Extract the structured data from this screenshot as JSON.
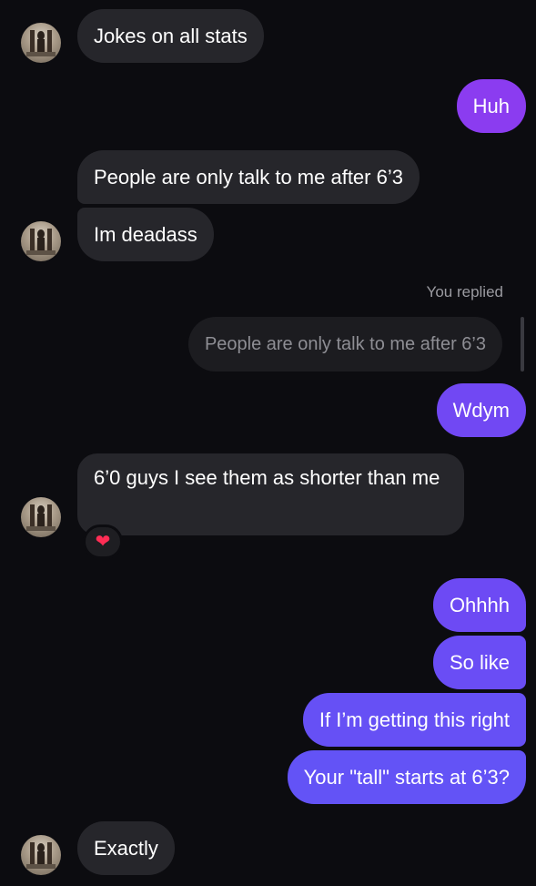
{
  "thread": {
    "messages": [
      {
        "sender": "them",
        "text": "Jokes on all stats"
      },
      {
        "sender": "me",
        "text": "Huh"
      },
      {
        "sender": "them",
        "text": "People are only talk to me after 6’3"
      },
      {
        "sender": "them",
        "text": "Im deadass"
      },
      {
        "sender": "me",
        "reply_label": "You replied",
        "quoted_text": "People are only talk to me after 6’3",
        "text": "Wdym"
      },
      {
        "sender": "them",
        "text": "6’0 guys I see them as shorter than me",
        "reaction": "❤"
      },
      {
        "sender": "me",
        "text": "Ohhhh"
      },
      {
        "sender": "me",
        "text": "So like"
      },
      {
        "sender": "me",
        "text": "If I’m getting this right"
      },
      {
        "sender": "me",
        "text": "Your \"tall\" starts at 6’3?"
      },
      {
        "sender": "them",
        "text": "Exactly"
      }
    ]
  },
  "colors": {
    "background": "#0c0c10",
    "incoming_bubble": "#26262b",
    "outgoing_purple": "#8b3cf0",
    "outgoing_blue_violet": "#6a4df5"
  },
  "icons": {
    "avatar": "contact-avatar-icon",
    "reaction": "heart-icon"
  }
}
